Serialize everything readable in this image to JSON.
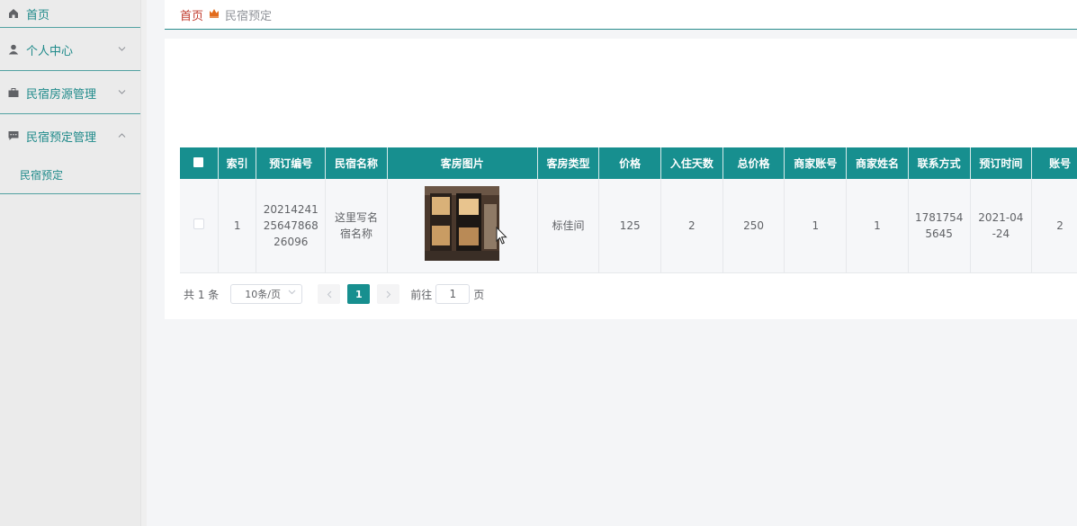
{
  "sidebar": {
    "items": [
      {
        "label": "首页",
        "icon": "home-icon"
      },
      {
        "label": "个人中心",
        "icon": "user-icon"
      },
      {
        "label": "民宿房源管理",
        "icon": "briefcase-icon"
      },
      {
        "label": "民宿预定管理",
        "icon": "message-icon"
      }
    ],
    "sub_item": "民宿预定"
  },
  "breadcrumb": {
    "home": "首页",
    "current": "民宿预定"
  },
  "table": {
    "headers": [
      "索引",
      "预订编号",
      "民宿名称",
      "客房图片",
      "客房类型",
      "价格",
      "入住天数",
      "总价格",
      "商家账号",
      "商家姓名",
      "联系方式",
      "预订时间",
      "账号"
    ],
    "row": {
      "index": "1",
      "order_no_1": "20214241",
      "order_no_2": "25647868",
      "order_no_3": "26096",
      "name_1": "这里写名",
      "name_2": "宿名称",
      "room_type": "标佳间",
      "price": "125",
      "days": "2",
      "total": "250",
      "merchant_account": "1",
      "merchant_name": "1",
      "phone_1": "1781754",
      "phone_2": "5645",
      "time_1": "2021-04",
      "time_2": "-24",
      "account": "2"
    }
  },
  "pagination": {
    "total": "共 1 条",
    "page_size": "10条/页",
    "current_page": "1",
    "goto_prefix": "前往",
    "goto_value": "1",
    "goto_suffix": "页"
  },
  "colors": {
    "accent": "#178f8f",
    "crumb_home": "#c0392b"
  }
}
